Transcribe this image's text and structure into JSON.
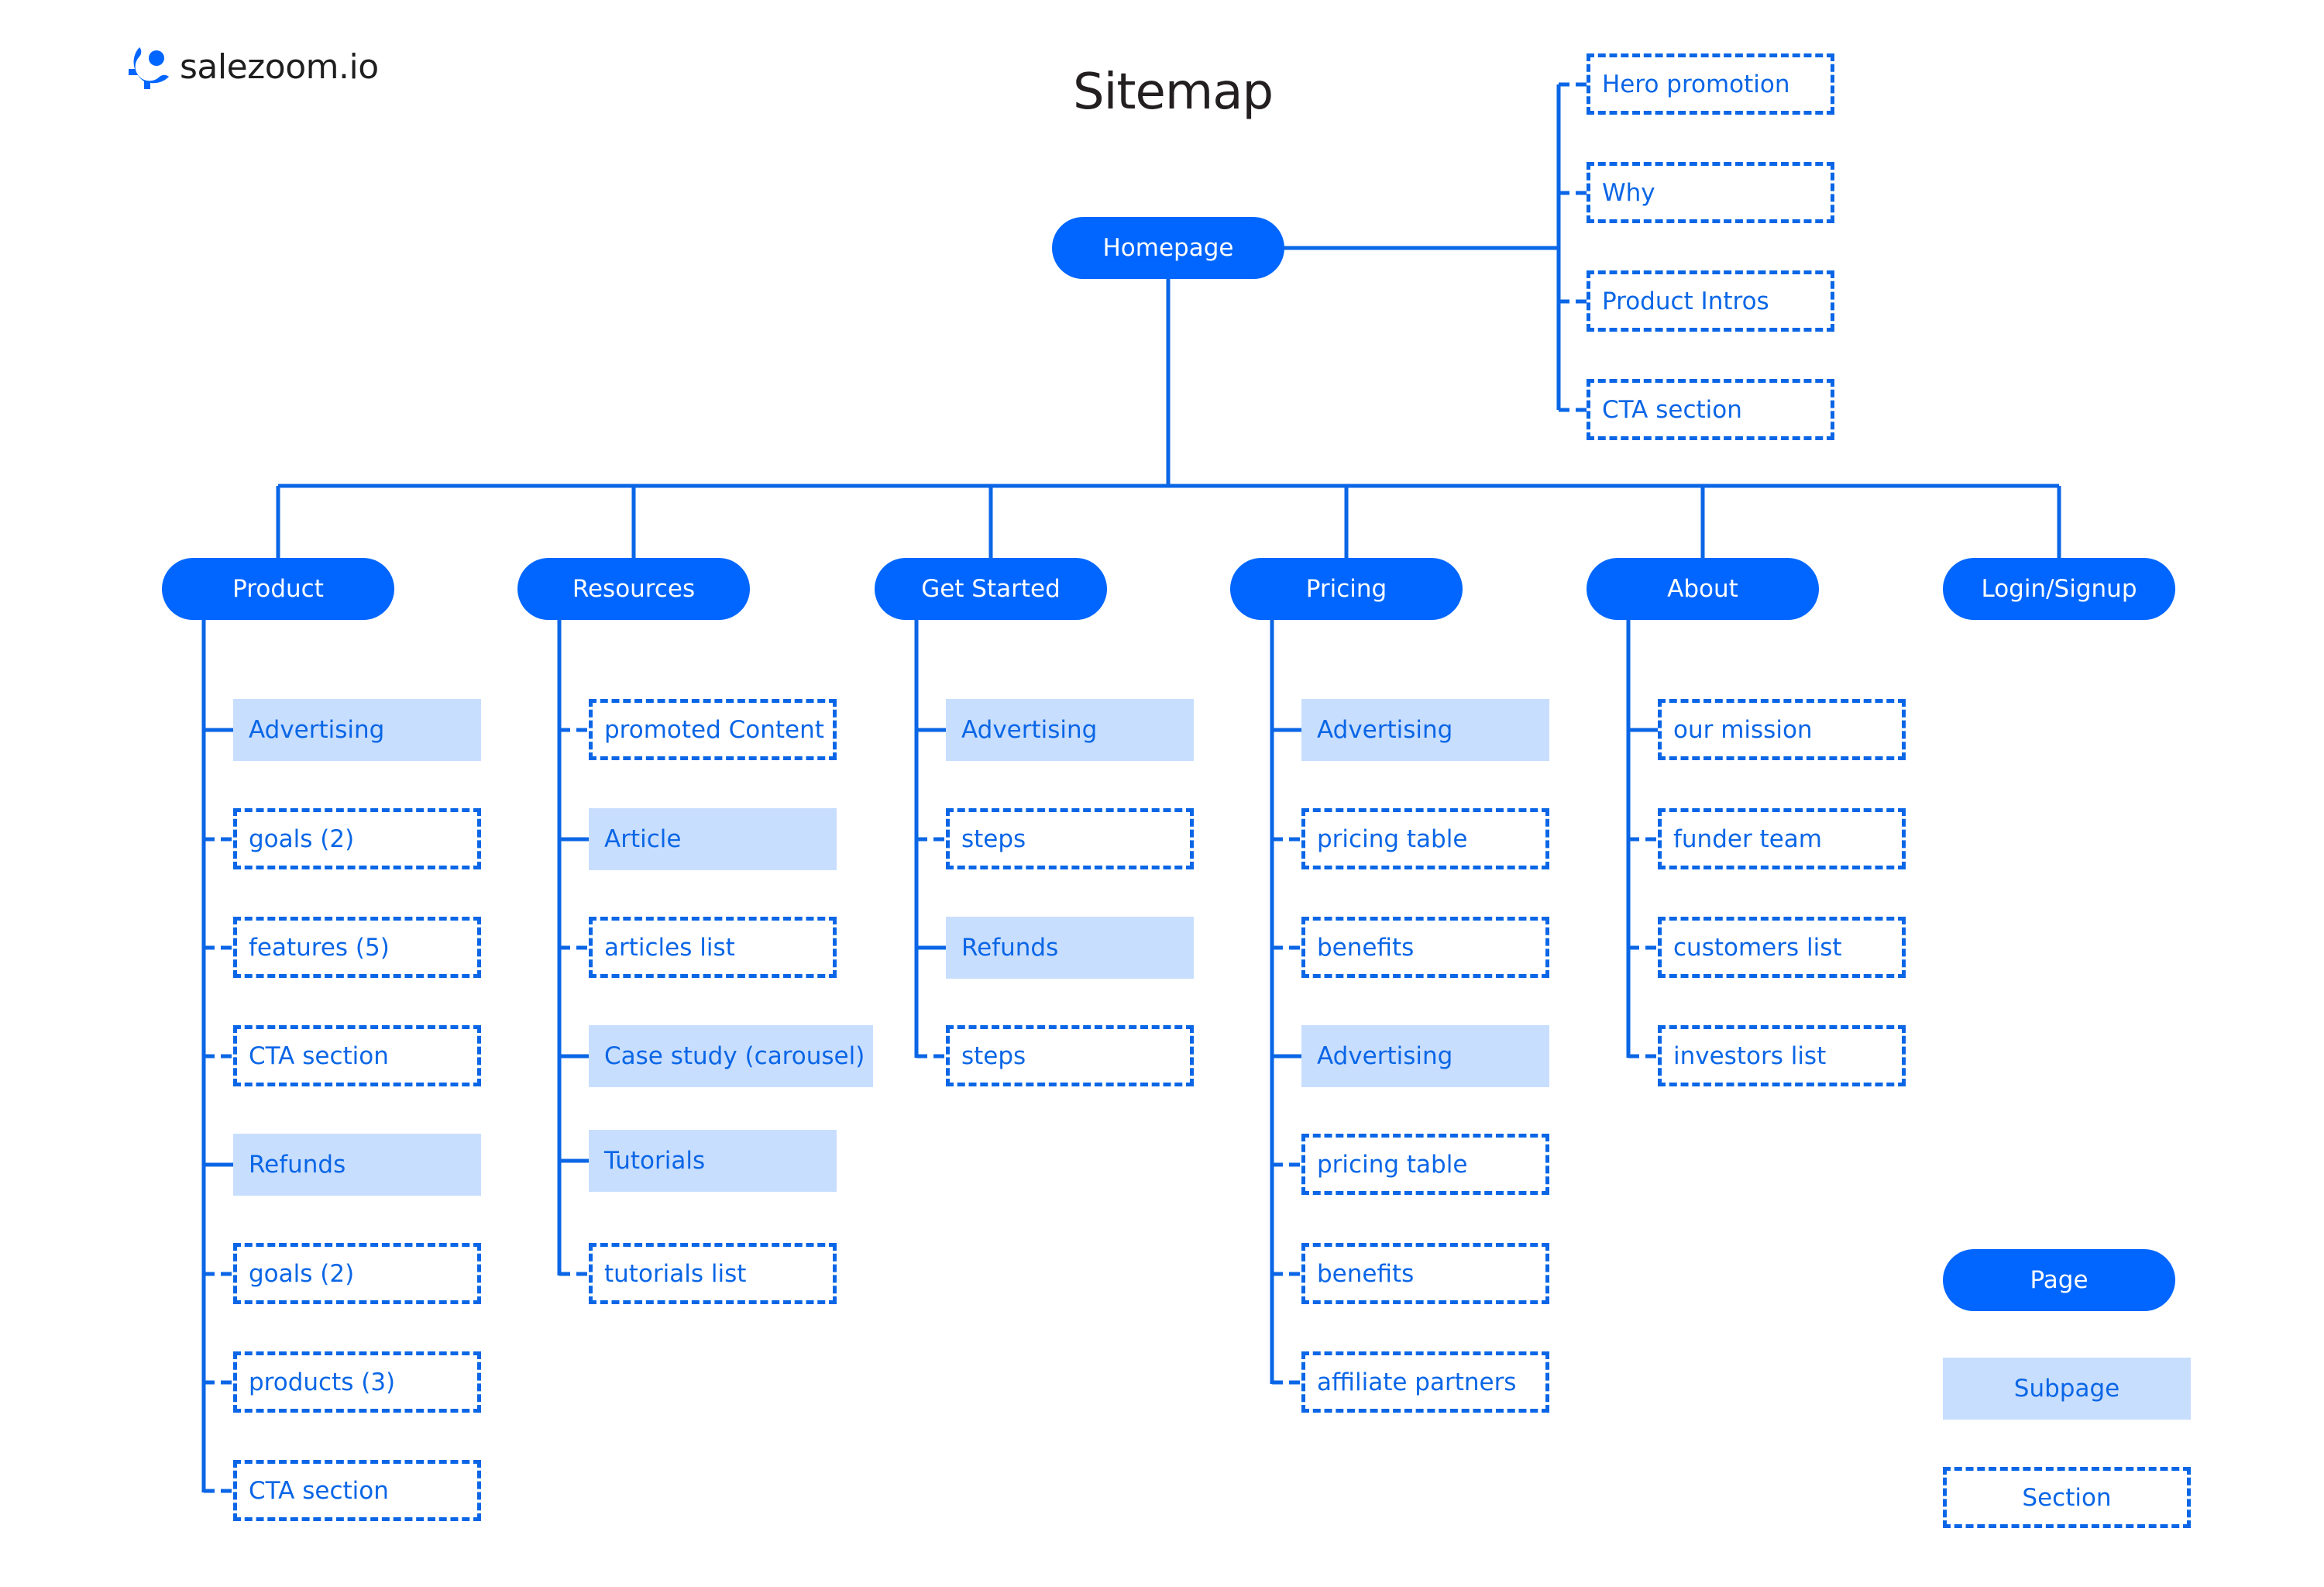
{
  "brand": {
    "name": "salezoom.io",
    "icon": "salezoom-logo-icon"
  },
  "title": "Sitemap",
  "colors": {
    "page": "#0066ff",
    "subpage_fill": "#c8deff",
    "text_accent": "#0a66e6",
    "title": "#231f20",
    "line": "#0a66e6"
  },
  "homepage": {
    "label": "Homepage",
    "sections": [
      "Hero promotion",
      "Why",
      "Product Intros",
      "CTA section"
    ]
  },
  "pages": [
    {
      "label": "Product",
      "children": [
        {
          "label": "Advertising",
          "type": "subpage"
        },
        {
          "label": "goals (2)",
          "type": "section"
        },
        {
          "label": "features (5)",
          "type": "section"
        },
        {
          "label": "CTA section",
          "type": "section"
        },
        {
          "label": "Refunds",
          "type": "subpage"
        },
        {
          "label": "goals (2)",
          "type": "section"
        },
        {
          "label": "products (3)",
          "type": "section"
        },
        {
          "label": "CTA section",
          "type": "section"
        }
      ]
    },
    {
      "label": "Resources",
      "children": [
        {
          "label": "promoted Content",
          "type": "section"
        },
        {
          "label": "Article",
          "type": "subpage"
        },
        {
          "label": "articles list",
          "type": "section"
        },
        {
          "label": "Case study (carousel)",
          "type": "subpage"
        },
        {
          "label": "Tutorials",
          "type": "subpage"
        },
        {
          "label": "tutorials list",
          "type": "section"
        }
      ]
    },
    {
      "label": "Get Started",
      "children": [
        {
          "label": "Advertising",
          "type": "subpage"
        },
        {
          "label": "steps",
          "type": "section"
        },
        {
          "label": "Refunds",
          "type": "subpage"
        },
        {
          "label": "steps",
          "type": "section"
        }
      ]
    },
    {
      "label": "Pricing",
      "children": [
        {
          "label": "Advertising",
          "type": "subpage"
        },
        {
          "label": "pricing table",
          "type": "section"
        },
        {
          "label": "benefits",
          "type": "section"
        },
        {
          "label": "Advertising",
          "type": "subpage"
        },
        {
          "label": "pricing table",
          "type": "section"
        },
        {
          "label": "benefits",
          "type": "section"
        },
        {
          "label": "affiliate partners",
          "type": "section"
        }
      ]
    },
    {
      "label": "About",
      "children": [
        {
          "label": "our mission",
          "type": "section"
        },
        {
          "label": "funder team",
          "type": "section"
        },
        {
          "label": "customers list",
          "type": "section"
        },
        {
          "label": "investors list",
          "type": "section"
        }
      ]
    },
    {
      "label": "Login/Signup",
      "children": []
    }
  ],
  "legend": [
    {
      "label": "Page",
      "type": "page"
    },
    {
      "label": "Subpage",
      "type": "subpage"
    },
    {
      "label": "Section",
      "type": "section"
    }
  ]
}
